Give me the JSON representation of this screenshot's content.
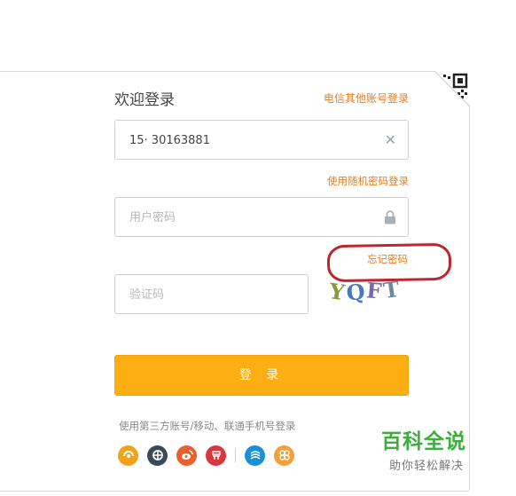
{
  "header": {
    "title": "欢迎登录",
    "other_account_link": "电信其他账号登录"
  },
  "account": {
    "value": "15· 30163881"
  },
  "random_password_link": "使用随机密码登录",
  "password": {
    "placeholder": "用户密码"
  },
  "forgot_password_link": "忘记密码",
  "captcha": {
    "placeholder": "验证码",
    "image_text": "YQFT"
  },
  "login_button": "登 录",
  "third_party": {
    "text": "使用第三方账号/移动、联通手机号登录",
    "icons": [
      "yixin-icon",
      "tianyi-icon",
      "weibo-icon",
      "netease-icon",
      "china-mobile-icon",
      "china-unicom-icon"
    ]
  },
  "watermark": {
    "title": "百科全说",
    "subtitle": "助你轻松解决"
  },
  "colors": {
    "accent_orange": "#e67e22",
    "button_yellow": "#fcae12",
    "highlight_red": "#c0242f",
    "watermark_green": "#3cae3c"
  }
}
